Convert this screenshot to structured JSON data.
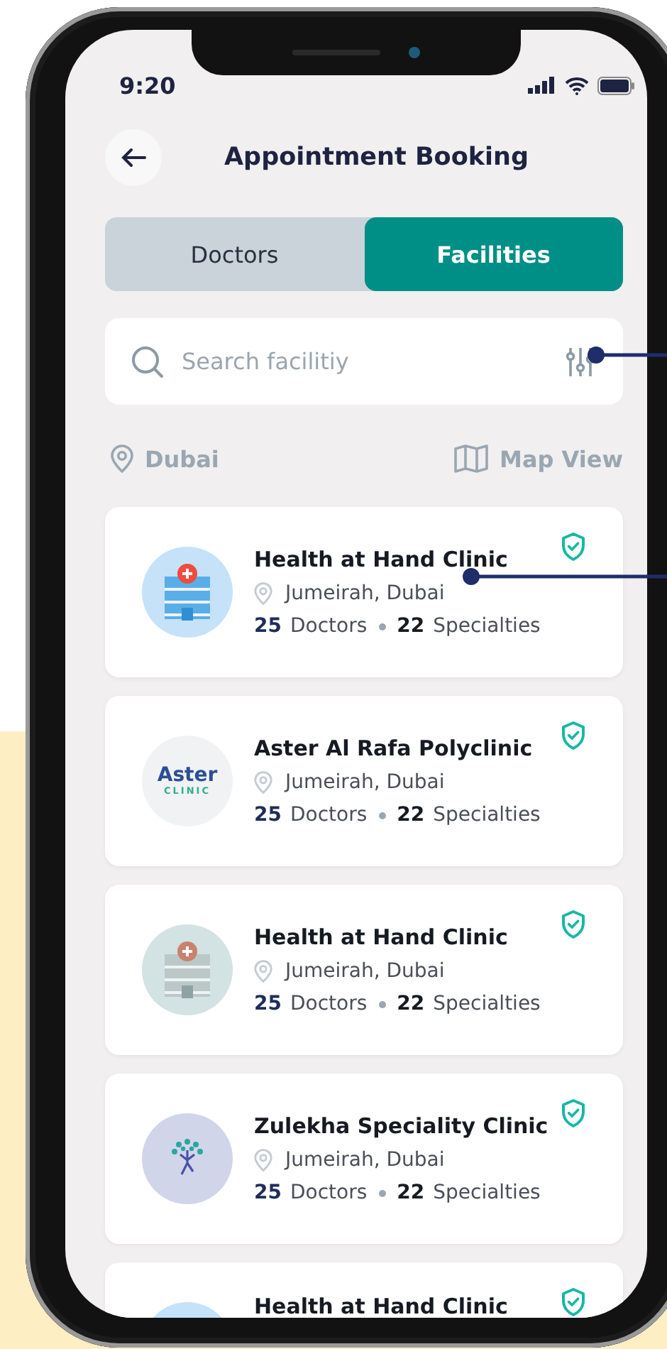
{
  "status_bar": {
    "time": "9:20"
  },
  "header": {
    "title": "Appointment Booking"
  },
  "tabs": [
    {
      "label": "Doctors",
      "selected": false
    },
    {
      "label": "Facilities",
      "selected": true
    }
  ],
  "search": {
    "placeholder": "Search facilitiy"
  },
  "location": {
    "city": "Dubai",
    "map_link": "Map View"
  },
  "facilities": [
    {
      "name": "Health at Hand Clinic",
      "location": "Jumeirah, Dubai",
      "verified": true,
      "doctors": "25",
      "doctors_label": "Doctors",
      "specialties": "22",
      "specialties_label": "Specialties",
      "logo": {
        "kind": "building",
        "color": "#c5e2f8"
      }
    },
    {
      "name": "Aster Al Rafa Polyclinic",
      "location": "Jumeirah, Dubai",
      "verified": true,
      "doctors": "25",
      "doctors_label": "Doctors",
      "specialties": "22",
      "specialties_label": "Specialties",
      "logo": {
        "kind": "wordmark",
        "color": "#f1f2f4",
        "text": "Aster",
        "subtext": "CLINIC"
      }
    },
    {
      "name": "Health at Hand Clinic",
      "location": "Jumeirah, Dubai",
      "verified": true,
      "doctors": "25",
      "doctors_label": "Doctors",
      "specialties": "22",
      "specialties_label": "Specialties",
      "logo": {
        "kind": "building",
        "color": "#d3e2e3"
      }
    },
    {
      "name": "Zulekha Speciality Clinic",
      "location": "Jumeirah, Dubai",
      "verified": true,
      "doctors": "25",
      "doctors_label": "Doctors",
      "specialties": "22",
      "specialties_label": "Specialties",
      "logo": {
        "kind": "tree",
        "color": "#d1d5ea"
      }
    },
    {
      "name": "Health at Hand Clinic",
      "verified": true,
      "logo": {
        "kind": "building",
        "color": "#c5e2f8"
      }
    }
  ]
}
